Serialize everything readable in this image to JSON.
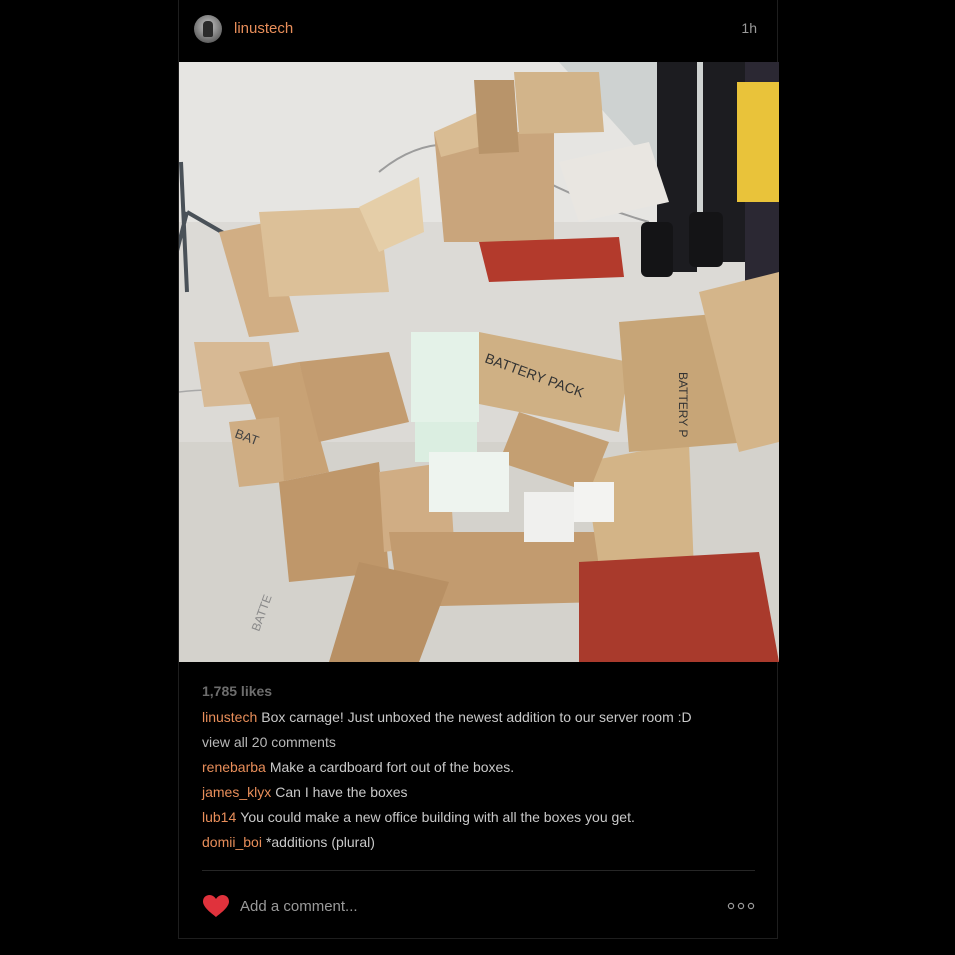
{
  "post": {
    "username": "linustech",
    "time_ago": "1h",
    "likes": "1,785 likes",
    "caption": {
      "user": "linustech",
      "text": "Box carnage! Just unboxed the newest addition to our server room :D"
    },
    "view_all_comments": "view all 20 comments",
    "comments": [
      {
        "user": "renebarba",
        "text": "Make a cardboard fort out of the boxes."
      },
      {
        "user": "james_klyx",
        "text": "Can I have the boxes"
      },
      {
        "user": "lub14",
        "text": "You could make a new office building with all the boxes you get."
      },
      {
        "user": "domii_boi",
        "text": "*additions (plural)"
      }
    ],
    "add_comment_placeholder": "Add a comment...",
    "photo_text": {
      "box_label_1": "BATTERY PACK",
      "box_label_2": "BATTERY P",
      "box_label_3": "BAT",
      "box_label_4": "BATTE"
    }
  },
  "icons": {
    "like": "heart-icon",
    "options": "more-options-icon",
    "avatar": "avatar"
  },
  "colors": {
    "background": "#000000",
    "username": "#e88e5a",
    "heart": "#e0323c",
    "text": "#c9c9c9",
    "muted": "#6d6d6d"
  }
}
